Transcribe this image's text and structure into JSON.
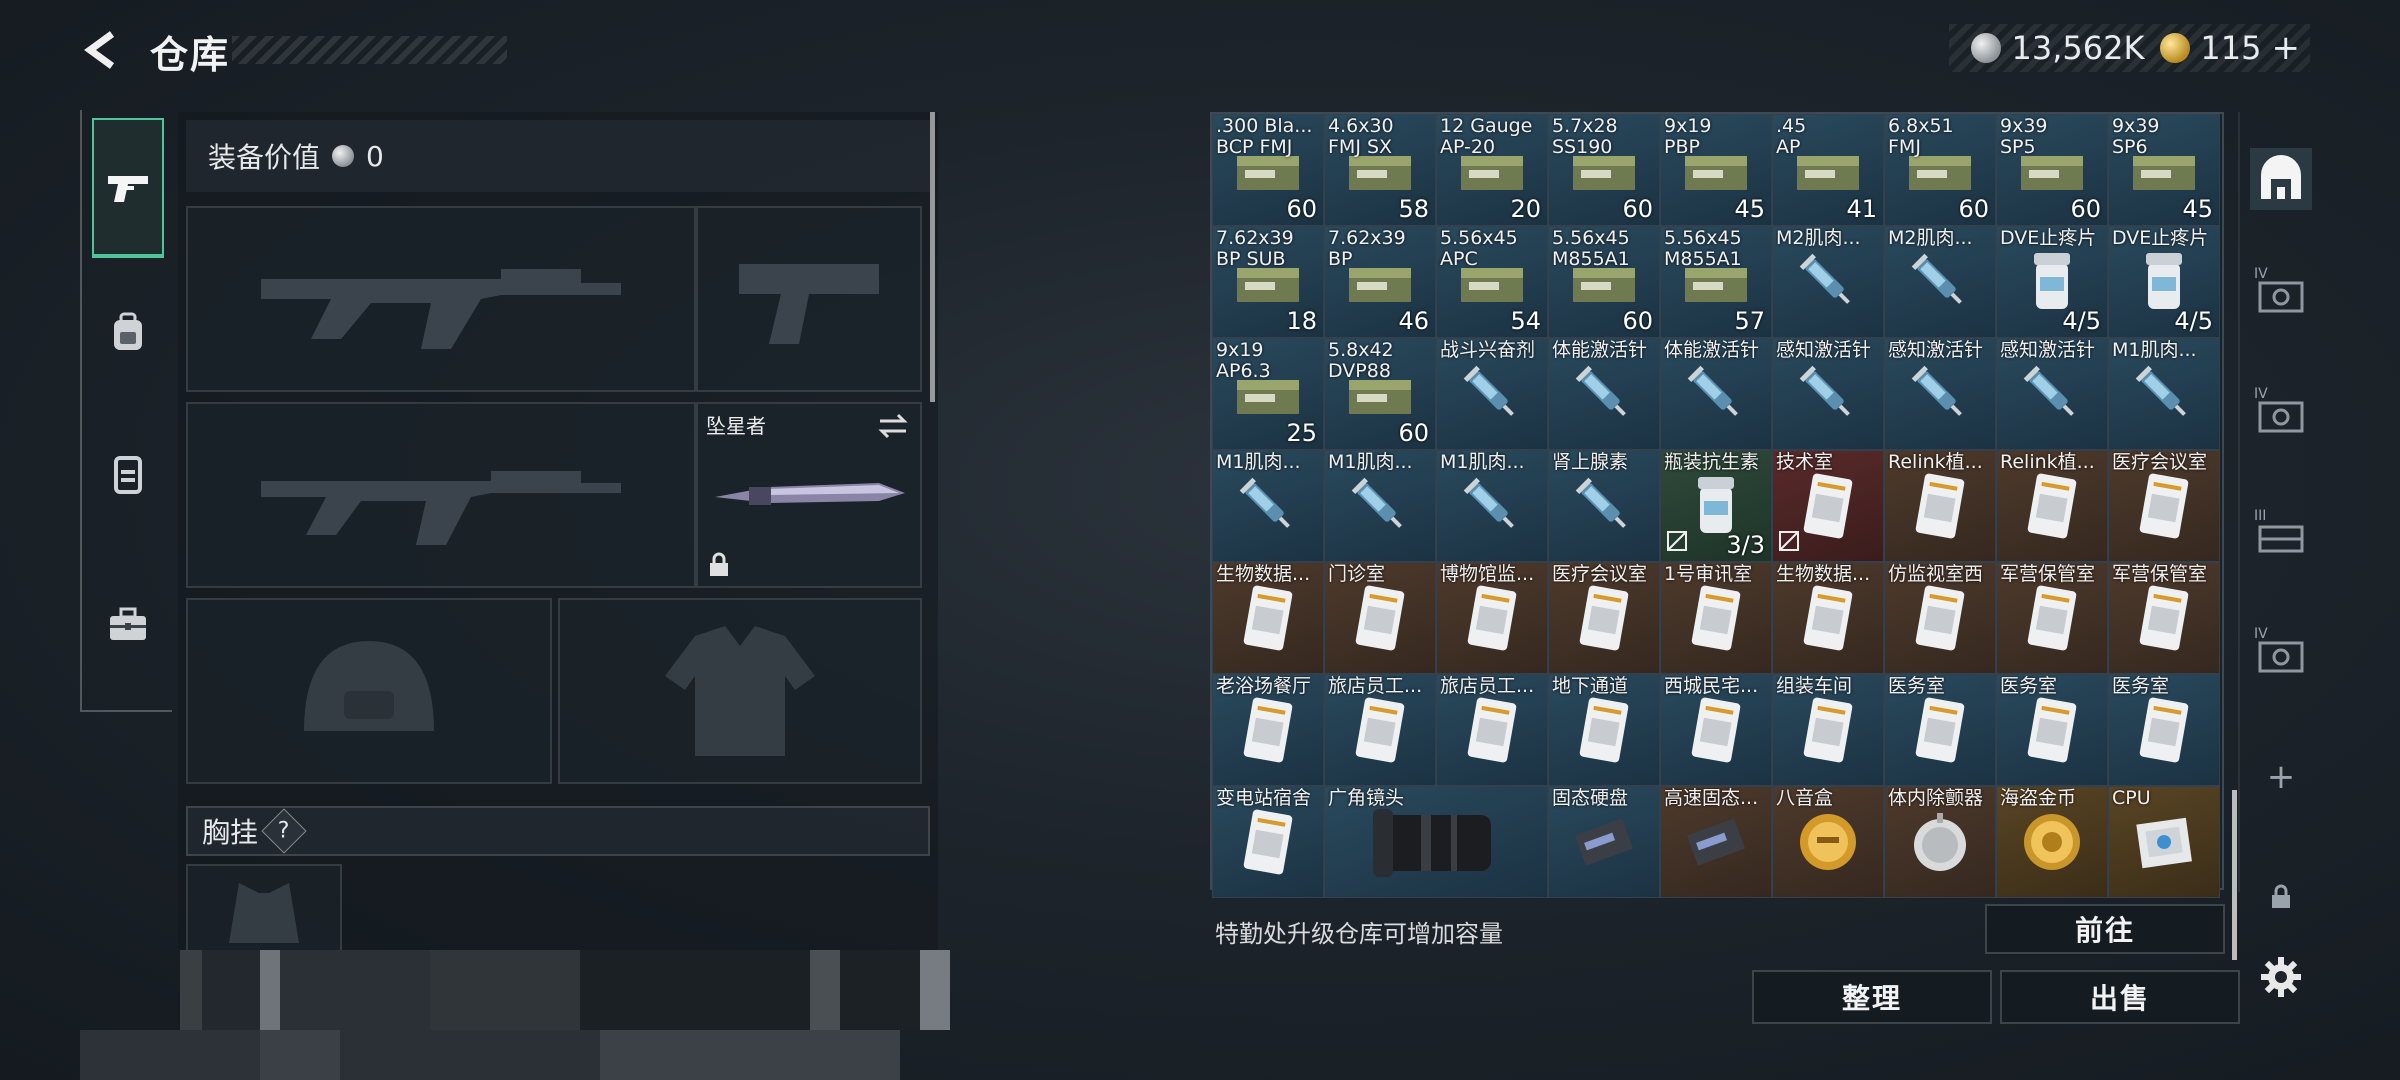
{
  "header": {
    "title": "仓库",
    "currency_silver": "13,562K",
    "currency_gold": "115",
    "gold_plus": "+"
  },
  "loadout": {
    "equip_value_label": "装备价值",
    "equip_value": "0",
    "melee_name": "坠星者",
    "chest_label": "胸挂",
    "chest_help": "?"
  },
  "warehouse": {
    "rows": [
      [
        {
          "name": ".300 Bla...",
          "name2": "BCP FMJ",
          "count": "60",
          "color": "blue",
          "icon": "ammo-box-icon"
        },
        {
          "name": "4.6x30",
          "name2": "FMJ SX",
          "count": "58",
          "color": "blue",
          "icon": "ammo-box-icon"
        },
        {
          "name": "12 Gauge",
          "name2": "AP-20",
          "count": "20",
          "color": "blue",
          "icon": "ammo-box-icon"
        },
        {
          "name": "5.7x28",
          "name2": "SS190",
          "count": "60",
          "color": "blue",
          "icon": "ammo-box-icon"
        },
        {
          "name": "9x19",
          "name2": "PBP",
          "count": "45",
          "color": "blue",
          "icon": "ammo-box-icon"
        },
        {
          "name": ".45",
          "name2": "AP",
          "count": "41",
          "color": "blue",
          "icon": "ammo-box-icon"
        },
        {
          "name": "6.8x51",
          "name2": "FMJ",
          "count": "60",
          "color": "blue",
          "icon": "ammo-box-icon"
        },
        {
          "name": "9x39",
          "name2": "SP5",
          "count": "60",
          "color": "blue",
          "icon": "ammo-box-icon"
        },
        {
          "name": "9x39",
          "name2": "SP6",
          "count": "45",
          "color": "blue",
          "icon": "ammo-box-icon"
        }
      ],
      [
        {
          "name": "7.62x39",
          "name2": "BP SUB",
          "count": "18",
          "color": "blue",
          "icon": "ammo-box-icon"
        },
        {
          "name": "7.62x39",
          "name2": "BP",
          "count": "46",
          "color": "blue",
          "icon": "ammo-box-icon"
        },
        {
          "name": "5.56x45",
          "name2": "APC",
          "count": "54",
          "color": "blue",
          "icon": "ammo-box-icon"
        },
        {
          "name": "5.56x45",
          "name2": "M855A1",
          "count": "60",
          "color": "blue",
          "icon": "ammo-box-icon"
        },
        {
          "name": "5.56x45",
          "name2": "M855A1",
          "count": "57",
          "color": "blue",
          "icon": "ammo-box-icon"
        },
        {
          "name": "M2肌肉...",
          "name2": "",
          "count": "",
          "color": "blue",
          "icon": "syringe-icon"
        },
        {
          "name": "M2肌肉...",
          "name2": "",
          "count": "",
          "color": "blue",
          "icon": "syringe-icon"
        },
        {
          "name": "DVE止疼片",
          "name2": "",
          "count": "4/5",
          "color": "blue",
          "icon": "pill-bottle-icon"
        },
        {
          "name": "DVE止疼片",
          "name2": "",
          "count": "4/5",
          "color": "blue",
          "icon": "pill-bottle-icon"
        }
      ],
      [
        {
          "name": "9x19",
          "name2": "AP6.3",
          "count": "25",
          "color": "blue",
          "icon": "ammo-box-icon"
        },
        {
          "name": "5.8x42",
          "name2": "DVP88",
          "count": "60",
          "color": "blue",
          "icon": "ammo-box-icon"
        },
        {
          "name": "战斗兴奋剂",
          "name2": "",
          "count": "",
          "color": "blue",
          "icon": "syringe-icon"
        },
        {
          "name": "体能激活针",
          "name2": "",
          "count": "",
          "color": "blue",
          "icon": "syringe-icon"
        },
        {
          "name": "体能激活针",
          "name2": "",
          "count": "",
          "color": "blue",
          "icon": "syringe-icon"
        },
        {
          "name": "感知激活针",
          "name2": "",
          "count": "",
          "color": "blue",
          "icon": "syringe-icon"
        },
        {
          "name": "感知激活针",
          "name2": "",
          "count": "",
          "color": "blue",
          "icon": "syringe-icon"
        },
        {
          "name": "感知激活针",
          "name2": "",
          "count": "",
          "color": "blue",
          "icon": "syringe-icon"
        },
        {
          "name": "M1肌肉...",
          "name2": "",
          "count": "",
          "color": "blue",
          "icon": "syringe-icon"
        }
      ],
      [
        {
          "name": "M1肌肉...",
          "name2": "",
          "count": "",
          "color": "blue",
          "icon": "syringe-icon"
        },
        {
          "name": "M1肌肉...",
          "name2": "",
          "count": "",
          "color": "blue",
          "icon": "syringe-icon"
        },
        {
          "name": "M1肌肉...",
          "name2": "",
          "count": "",
          "color": "blue",
          "icon": "syringe-icon"
        },
        {
          "name": "肾上腺素",
          "name2": "",
          "count": "",
          "color": "blue",
          "icon": "syringe-icon"
        },
        {
          "name": "瓶装抗生素",
          "name2": "",
          "count": "3/3",
          "color": "green",
          "icon": "pill-bottle-icon",
          "badge": true
        },
        {
          "name": "技术室",
          "name2": "",
          "count": "",
          "color": "red",
          "icon": "keycard-icon",
          "badge": true
        },
        {
          "name": "Relink植...",
          "name2": "",
          "count": "",
          "color": "brown",
          "icon": "keycard-icon"
        },
        {
          "name": "Relink植...",
          "name2": "",
          "count": "",
          "color": "brown",
          "icon": "keycard-icon"
        },
        {
          "name": "医疗会议室",
          "name2": "",
          "count": "",
          "color": "brown",
          "icon": "keycard-icon"
        }
      ],
      [
        {
          "name": "生物数据...",
          "name2": "",
          "count": "",
          "color": "brown",
          "icon": "keycard-icon"
        },
        {
          "name": "门诊室",
          "name2": "",
          "count": "",
          "color": "brown",
          "icon": "keycard-icon"
        },
        {
          "name": "博物馆监...",
          "name2": "",
          "count": "",
          "color": "brown",
          "icon": "keycard-icon"
        },
        {
          "name": "医疗会议室",
          "name2": "",
          "count": "",
          "color": "brown",
          "icon": "keycard-icon"
        },
        {
          "name": "1号审讯室",
          "name2": "",
          "count": "",
          "color": "brown",
          "icon": "keycard-icon"
        },
        {
          "name": "生物数据...",
          "name2": "",
          "count": "",
          "color": "brown",
          "icon": "keycard-icon"
        },
        {
          "name": "仿监视室西",
          "name2": "",
          "count": "",
          "color": "brown",
          "icon": "keycard-icon"
        },
        {
          "name": "军营保管室",
          "name2": "",
          "count": "",
          "color": "brown",
          "icon": "keycard-icon"
        },
        {
          "name": "军营保管室",
          "name2": "",
          "count": "",
          "color": "brown",
          "icon": "keycard-icon"
        }
      ],
      [
        {
          "name": "老浴场餐厅",
          "name2": "",
          "count": "",
          "color": "blue",
          "icon": "keycard-icon"
        },
        {
          "name": "旅店员工...",
          "name2": "",
          "count": "",
          "color": "blue",
          "icon": "keycard-icon"
        },
        {
          "name": "旅店员工...",
          "name2": "",
          "count": "",
          "color": "blue",
          "icon": "keycard-icon"
        },
        {
          "name": "地下通道",
          "name2": "",
          "count": "",
          "color": "blue",
          "icon": "keycard-icon"
        },
        {
          "name": "西城民宅...",
          "name2": "",
          "count": "",
          "color": "blue",
          "icon": "keycard-icon"
        },
        {
          "name": "组装车间",
          "name2": "",
          "count": "",
          "color": "blue",
          "icon": "keycard-icon"
        },
        {
          "name": "医务室",
          "name2": "",
          "count": "",
          "color": "blue",
          "icon": "keycard-icon"
        },
        {
          "name": "医务室",
          "name2": "",
          "count": "",
          "color": "blue",
          "icon": "keycard-icon"
        },
        {
          "name": "医务室",
          "name2": "",
          "count": "",
          "color": "blue",
          "icon": "keycard-icon"
        }
      ],
      [
        {
          "name": "变电站宿舍",
          "name2": "",
          "count": "",
          "color": "blue",
          "icon": "keycard-icon"
        },
        {
          "name": "广角镜头",
          "name2": "",
          "count": "",
          "color": "blue",
          "icon": "camera-lens-icon",
          "wide": true
        },
        {
          "name": "固态硬盘",
          "name2": "",
          "count": "",
          "color": "blue",
          "icon": "ssd-icon"
        },
        {
          "name": "高速固态...",
          "name2": "",
          "count": "",
          "color": "brown",
          "icon": "ssd-icon"
        },
        {
          "name": "八音盒",
          "name2": "",
          "count": "",
          "color": "brown",
          "icon": "music-box-icon"
        },
        {
          "name": "体内除颤器",
          "name2": "",
          "count": "",
          "color": "brown",
          "icon": "defibrillator-icon"
        },
        {
          "name": "海盗金币",
          "name2": "",
          "count": "",
          "color": "gold",
          "icon": "gold-coin-icon"
        },
        {
          "name": "CPU",
          "name2": "",
          "count": "",
          "color": "gold",
          "icon": "cpu-icon"
        }
      ]
    ],
    "upgrade_tip": "特勤处升级仓库可增加容量",
    "goto_label": "前往",
    "sort_label": "整理",
    "sell_label": "出售"
  },
  "rail": {
    "items": [
      {
        "name": "rail-item-warehouse",
        "label": ""
      },
      {
        "name": "rail-item-ext-1",
        "label": "IV"
      },
      {
        "name": "rail-item-ext-2",
        "label": "IV"
      },
      {
        "name": "rail-item-ext-3",
        "label": "III"
      },
      {
        "name": "rail-item-ext-4",
        "label": "IV"
      }
    ],
    "add_symbol": "+"
  },
  "colors": {
    "accent_green": "#4fc69a",
    "cell_blue": "#2a4a5e",
    "cell_brown": "#4e3a2c",
    "cell_red": "#5a2a2a",
    "cell_gold": "#5a4524"
  }
}
